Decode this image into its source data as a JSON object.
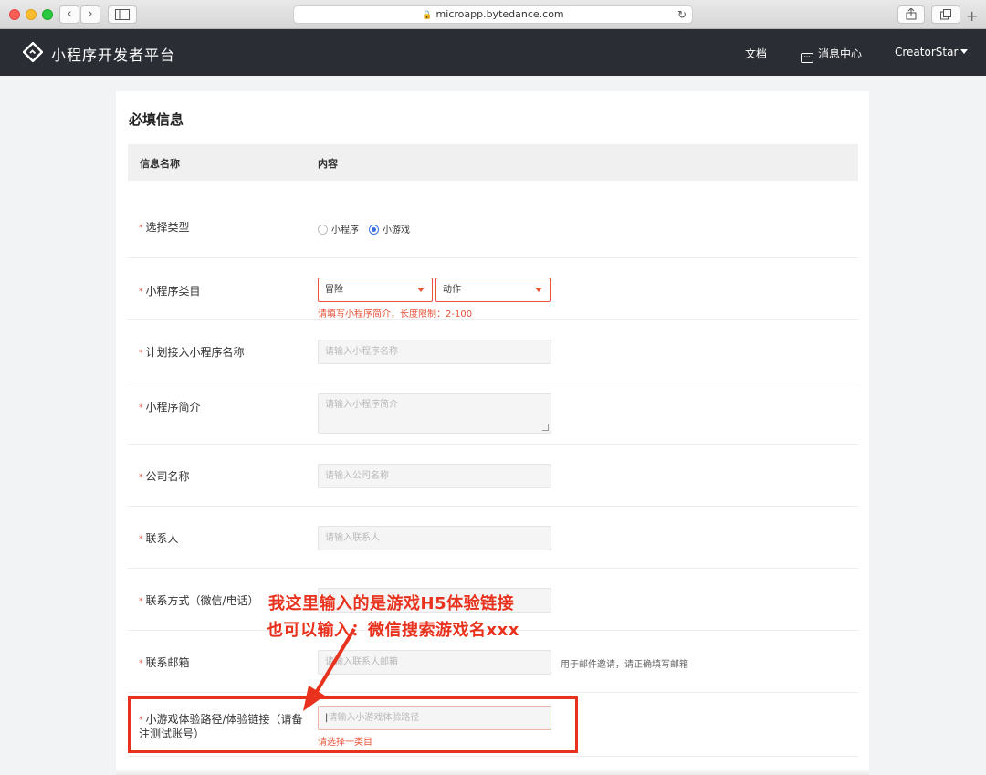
{
  "browser": {
    "url": "microapp.bytedance.com",
    "back_glyph": "‹",
    "forward_glyph": "›",
    "reload_glyph": "↻"
  },
  "nav": {
    "brand": "小程序开发者平台",
    "docs": "文档",
    "messages": "消息中心",
    "user": "CreatorStar"
  },
  "form": {
    "section_title": "必填信息",
    "header_name": "信息名称",
    "header_content": "内容",
    "type": {
      "label": "选择类型",
      "options": [
        "小程序",
        "小游戏"
      ],
      "selected": "小游戏"
    },
    "category": {
      "label": "小程序类目",
      "primary": "冒险",
      "secondary": "动作",
      "error": "请填写小程序简介，长度限制：2-100"
    },
    "app_name": {
      "label": "计划接入小程序名称",
      "placeholder": "请输入小程序名称"
    },
    "intro": {
      "label": "小程序简介",
      "placeholder": "请输入小程序简介"
    },
    "company": {
      "label": "公司名称",
      "placeholder": "请输入公司名称"
    },
    "contact": {
      "label": "联系人",
      "placeholder": "请输入联系人"
    },
    "contact_method": {
      "label": "联系方式（微信/电话）",
      "placeholder": ""
    },
    "email": {
      "label": "联系邮箱",
      "placeholder": "请输入联系人邮箱",
      "hint": "用于邮件邀请，请正确填写邮箱"
    },
    "game_path": {
      "label_line1": "小游戏体验路径/体验链接（请备",
      "label_line2": "注测试账号）",
      "placeholder": "请输入小游戏体验路径",
      "error": "请选择一类目"
    }
  },
  "annotation": {
    "line1": "我这里输入的是游戏H5体验链接",
    "line2": "也可以输入：微信搜索游戏名xxx"
  },
  "colors": {
    "nav_bg": "#2a2d33",
    "error_red": "#e8533a",
    "annotation_red": "#e8321e",
    "radio_blue": "#3b6fe0"
  }
}
